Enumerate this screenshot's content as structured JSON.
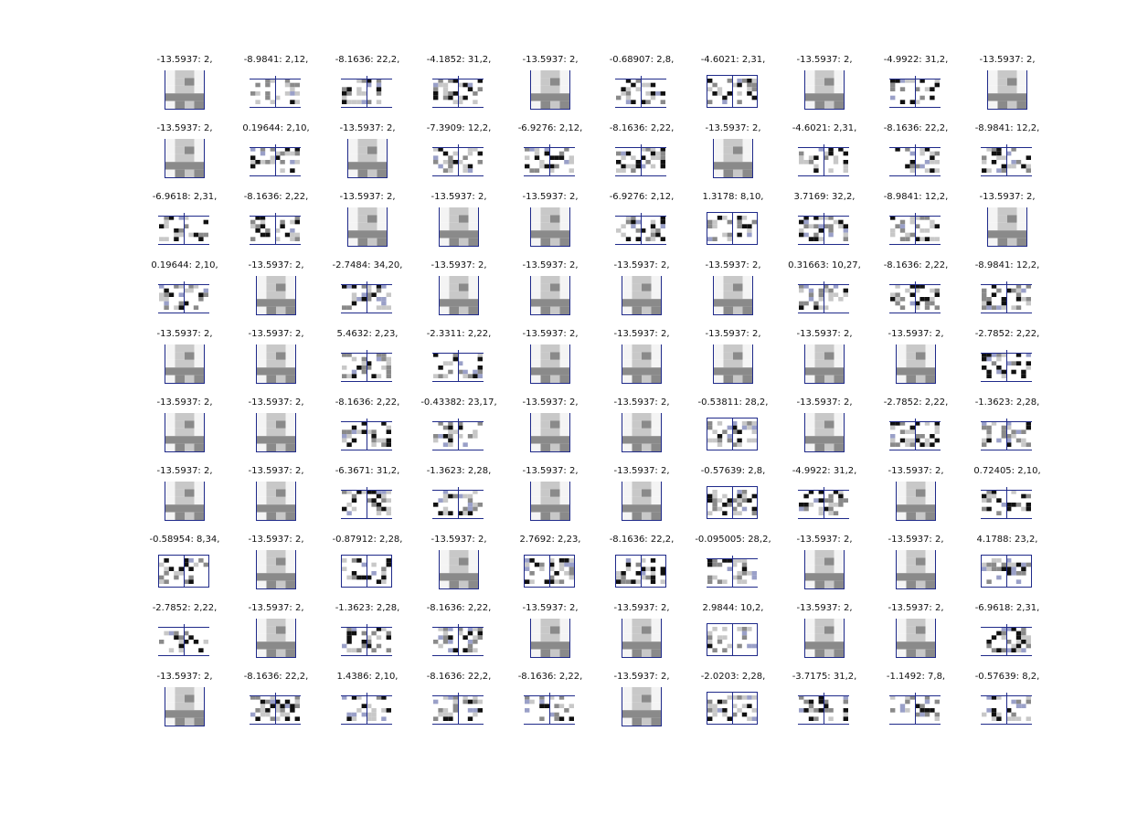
{
  "figure": {
    "frame_color": "#1f2a8a",
    "dark_pixel": "#111111",
    "mid_pixel": "#8a8a8a",
    "light_pixel": "#c8c8c8",
    "tint_pixel": "#9aa0c8",
    "rows": [
      [
        {
          "label": "-13.5937: 2,",
          "kind": "single"
        },
        {
          "label": "-8.9841: 2,12,",
          "kind": "pair_open"
        },
        {
          "label": "-8.1636: 22,2,",
          "kind": "pair_open"
        },
        {
          "label": "-4.1852: 31,2,",
          "kind": "pair_open"
        },
        {
          "label": "-13.5937: 2,",
          "kind": "single"
        },
        {
          "label": "-0.68907: 2,8,",
          "kind": "pair_open"
        },
        {
          "label": "-4.6021: 2,31,",
          "kind": "pair_box"
        },
        {
          "label": "-13.5937: 2,",
          "kind": "single"
        },
        {
          "label": "-4.9922: 31,2,",
          "kind": "pair_open"
        },
        {
          "label": "-13.5937: 2,",
          "kind": "single"
        }
      ],
      [
        {
          "label": "-13.5937: 2,",
          "kind": "single"
        },
        {
          "label": "0.19644: 2,10,",
          "kind": "pair_open"
        },
        {
          "label": "-13.5937: 2,",
          "kind": "single"
        },
        {
          "label": "-7.3909: 12,2,",
          "kind": "pair_open"
        },
        {
          "label": "-6.9276: 2,12,",
          "kind": "pair_open"
        },
        {
          "label": "-8.1636: 2,22,",
          "kind": "pair_open"
        },
        {
          "label": "-13.5937: 2,",
          "kind": "single"
        },
        {
          "label": "-4.6021: 2,31,",
          "kind": "pair_open"
        },
        {
          "label": "-8.1636: 22,2,",
          "kind": "pair_open"
        },
        {
          "label": "-8.9841: 12,2,",
          "kind": "pair_open"
        }
      ],
      [
        {
          "label": "-6.9618: 2,31,",
          "kind": "pair_open"
        },
        {
          "label": "-8.1636: 2,22,",
          "kind": "pair_open"
        },
        {
          "label": "-13.5937: 2,",
          "kind": "single"
        },
        {
          "label": "-13.5937: 2,",
          "kind": "single"
        },
        {
          "label": "-13.5937: 2,",
          "kind": "single"
        },
        {
          "label": "-6.9276: 2,12,",
          "kind": "pair_open"
        },
        {
          "label": "1.3178: 8,10,",
          "kind": "pair_box"
        },
        {
          "label": "3.7169: 32,2,",
          "kind": "pair_open"
        },
        {
          "label": "-8.9841: 12,2,",
          "kind": "pair_open"
        },
        {
          "label": "-13.5937: 2,",
          "kind": "single"
        }
      ],
      [
        {
          "label": "0.19644: 2,10,",
          "kind": "pair_open"
        },
        {
          "label": "-13.5937: 2,",
          "kind": "single"
        },
        {
          "label": "-2.7484: 34,20,",
          "kind": "pair_open"
        },
        {
          "label": "-13.5937: 2,",
          "kind": "single"
        },
        {
          "label": "-13.5937: 2,",
          "kind": "single"
        },
        {
          "label": "-13.5937: 2,",
          "kind": "single"
        },
        {
          "label": "-13.5937: 2,",
          "kind": "single"
        },
        {
          "label": "0.31663: 10,27,",
          "kind": "pair_open"
        },
        {
          "label": "-8.1636: 2,22,",
          "kind": "pair_open"
        },
        {
          "label": "-8.9841: 12,2,",
          "kind": "pair_open"
        }
      ],
      [
        {
          "label": "-13.5937: 2,",
          "kind": "single"
        },
        {
          "label": "-13.5937: 2,",
          "kind": "single"
        },
        {
          "label": "5.4632: 2,23,",
          "kind": "pair_open"
        },
        {
          "label": "-2.3311: 2,22,",
          "kind": "pair_open"
        },
        {
          "label": "-13.5937: 2,",
          "kind": "single"
        },
        {
          "label": "-13.5937: 2,",
          "kind": "single"
        },
        {
          "label": "-13.5937: 2,",
          "kind": "single"
        },
        {
          "label": "-13.5937: 2,",
          "kind": "single"
        },
        {
          "label": "-13.5937: 2,",
          "kind": "single"
        },
        {
          "label": "-2.7852: 2,22,",
          "kind": "pair_open"
        }
      ],
      [
        {
          "label": "-13.5937: 2,",
          "kind": "single"
        },
        {
          "label": "-13.5937: 2,",
          "kind": "single"
        },
        {
          "label": "-8.1636: 2,22,",
          "kind": "pair_open"
        },
        {
          "label": "-0.43382: 23,17,",
          "kind": "pair_open"
        },
        {
          "label": "-13.5937: 2,",
          "kind": "single"
        },
        {
          "label": "-13.5937: 2,",
          "kind": "single"
        },
        {
          "label": "-0.53811: 28,2,",
          "kind": "pair_box"
        },
        {
          "label": "-13.5937: 2,",
          "kind": "single"
        },
        {
          "label": "-2.7852: 2,22,",
          "kind": "pair_open"
        },
        {
          "label": "-1.3623: 2,28,",
          "kind": "pair_open"
        }
      ],
      [
        {
          "label": "-13.5937: 2,",
          "kind": "single"
        },
        {
          "label": "-13.5937: 2,",
          "kind": "single"
        },
        {
          "label": "-6.3671: 31,2,",
          "kind": "pair_open"
        },
        {
          "label": "-1.3623: 2,28,",
          "kind": "pair_open"
        },
        {
          "label": "-13.5937: 2,",
          "kind": "single"
        },
        {
          "label": "-13.5937: 2,",
          "kind": "single"
        },
        {
          "label": "-0.57639: 2,8,",
          "kind": "pair_box"
        },
        {
          "label": "-4.9922: 31,2,",
          "kind": "pair_open"
        },
        {
          "label": "-13.5937: 2,",
          "kind": "single"
        },
        {
          "label": "0.72405: 2,10,",
          "kind": "pair_open"
        }
      ],
      [
        {
          "label": "-0.58954: 8,34,",
          "kind": "pair_box"
        },
        {
          "label": "-13.5937: 2,",
          "kind": "single"
        },
        {
          "label": "-0.87912: 2,28,",
          "kind": "pair_box"
        },
        {
          "label": "-13.5937: 2,",
          "kind": "single"
        },
        {
          "label": "2.7692: 2,23,",
          "kind": "pair_box"
        },
        {
          "label": "-8.1636: 22,2,",
          "kind": "pair_box"
        },
        {
          "label": "-0.095005: 28,2,",
          "kind": "pair_open"
        },
        {
          "label": "-13.5937: 2,",
          "kind": "single"
        },
        {
          "label": "-13.5937: 2,",
          "kind": "single"
        },
        {
          "label": "4.1788: 23,2,",
          "kind": "pair_box"
        }
      ],
      [
        {
          "label": "-2.7852: 2,22,",
          "kind": "pair_open"
        },
        {
          "label": "-13.5937: 2,",
          "kind": "single"
        },
        {
          "label": "-1.3623: 2,28,",
          "kind": "pair_open"
        },
        {
          "label": "-8.1636: 2,22,",
          "kind": "pair_open"
        },
        {
          "label": "-13.5937: 2,",
          "kind": "single"
        },
        {
          "label": "-13.5937: 2,",
          "kind": "single"
        },
        {
          "label": "2.9844: 10,2,",
          "kind": "pair_box"
        },
        {
          "label": "-13.5937: 2,",
          "kind": "single"
        },
        {
          "label": "-13.5937: 2,",
          "kind": "single"
        },
        {
          "label": "-6.9618: 2,31,",
          "kind": "pair_open"
        }
      ],
      [
        {
          "label": "-13.5937: 2,",
          "kind": "single"
        },
        {
          "label": "-8.1636: 22,2,",
          "kind": "pair_open"
        },
        {
          "label": "1.4386: 2,10,",
          "kind": "pair_open"
        },
        {
          "label": "-8.1636: 22,2,",
          "kind": "pair_open"
        },
        {
          "label": "-8.1636: 2,22,",
          "kind": "pair_open"
        },
        {
          "label": "-13.5937: 2,",
          "kind": "single"
        },
        {
          "label": "-2.0203: 2,28,",
          "kind": "pair_box"
        },
        {
          "label": "-3.7175: 31,2,",
          "kind": "pair_open"
        },
        {
          "label": "-1.1492: 7,8,",
          "kind": "pair_open"
        },
        {
          "label": "-0.57639: 8,2,",
          "kind": "pair_open"
        }
      ]
    ]
  }
}
